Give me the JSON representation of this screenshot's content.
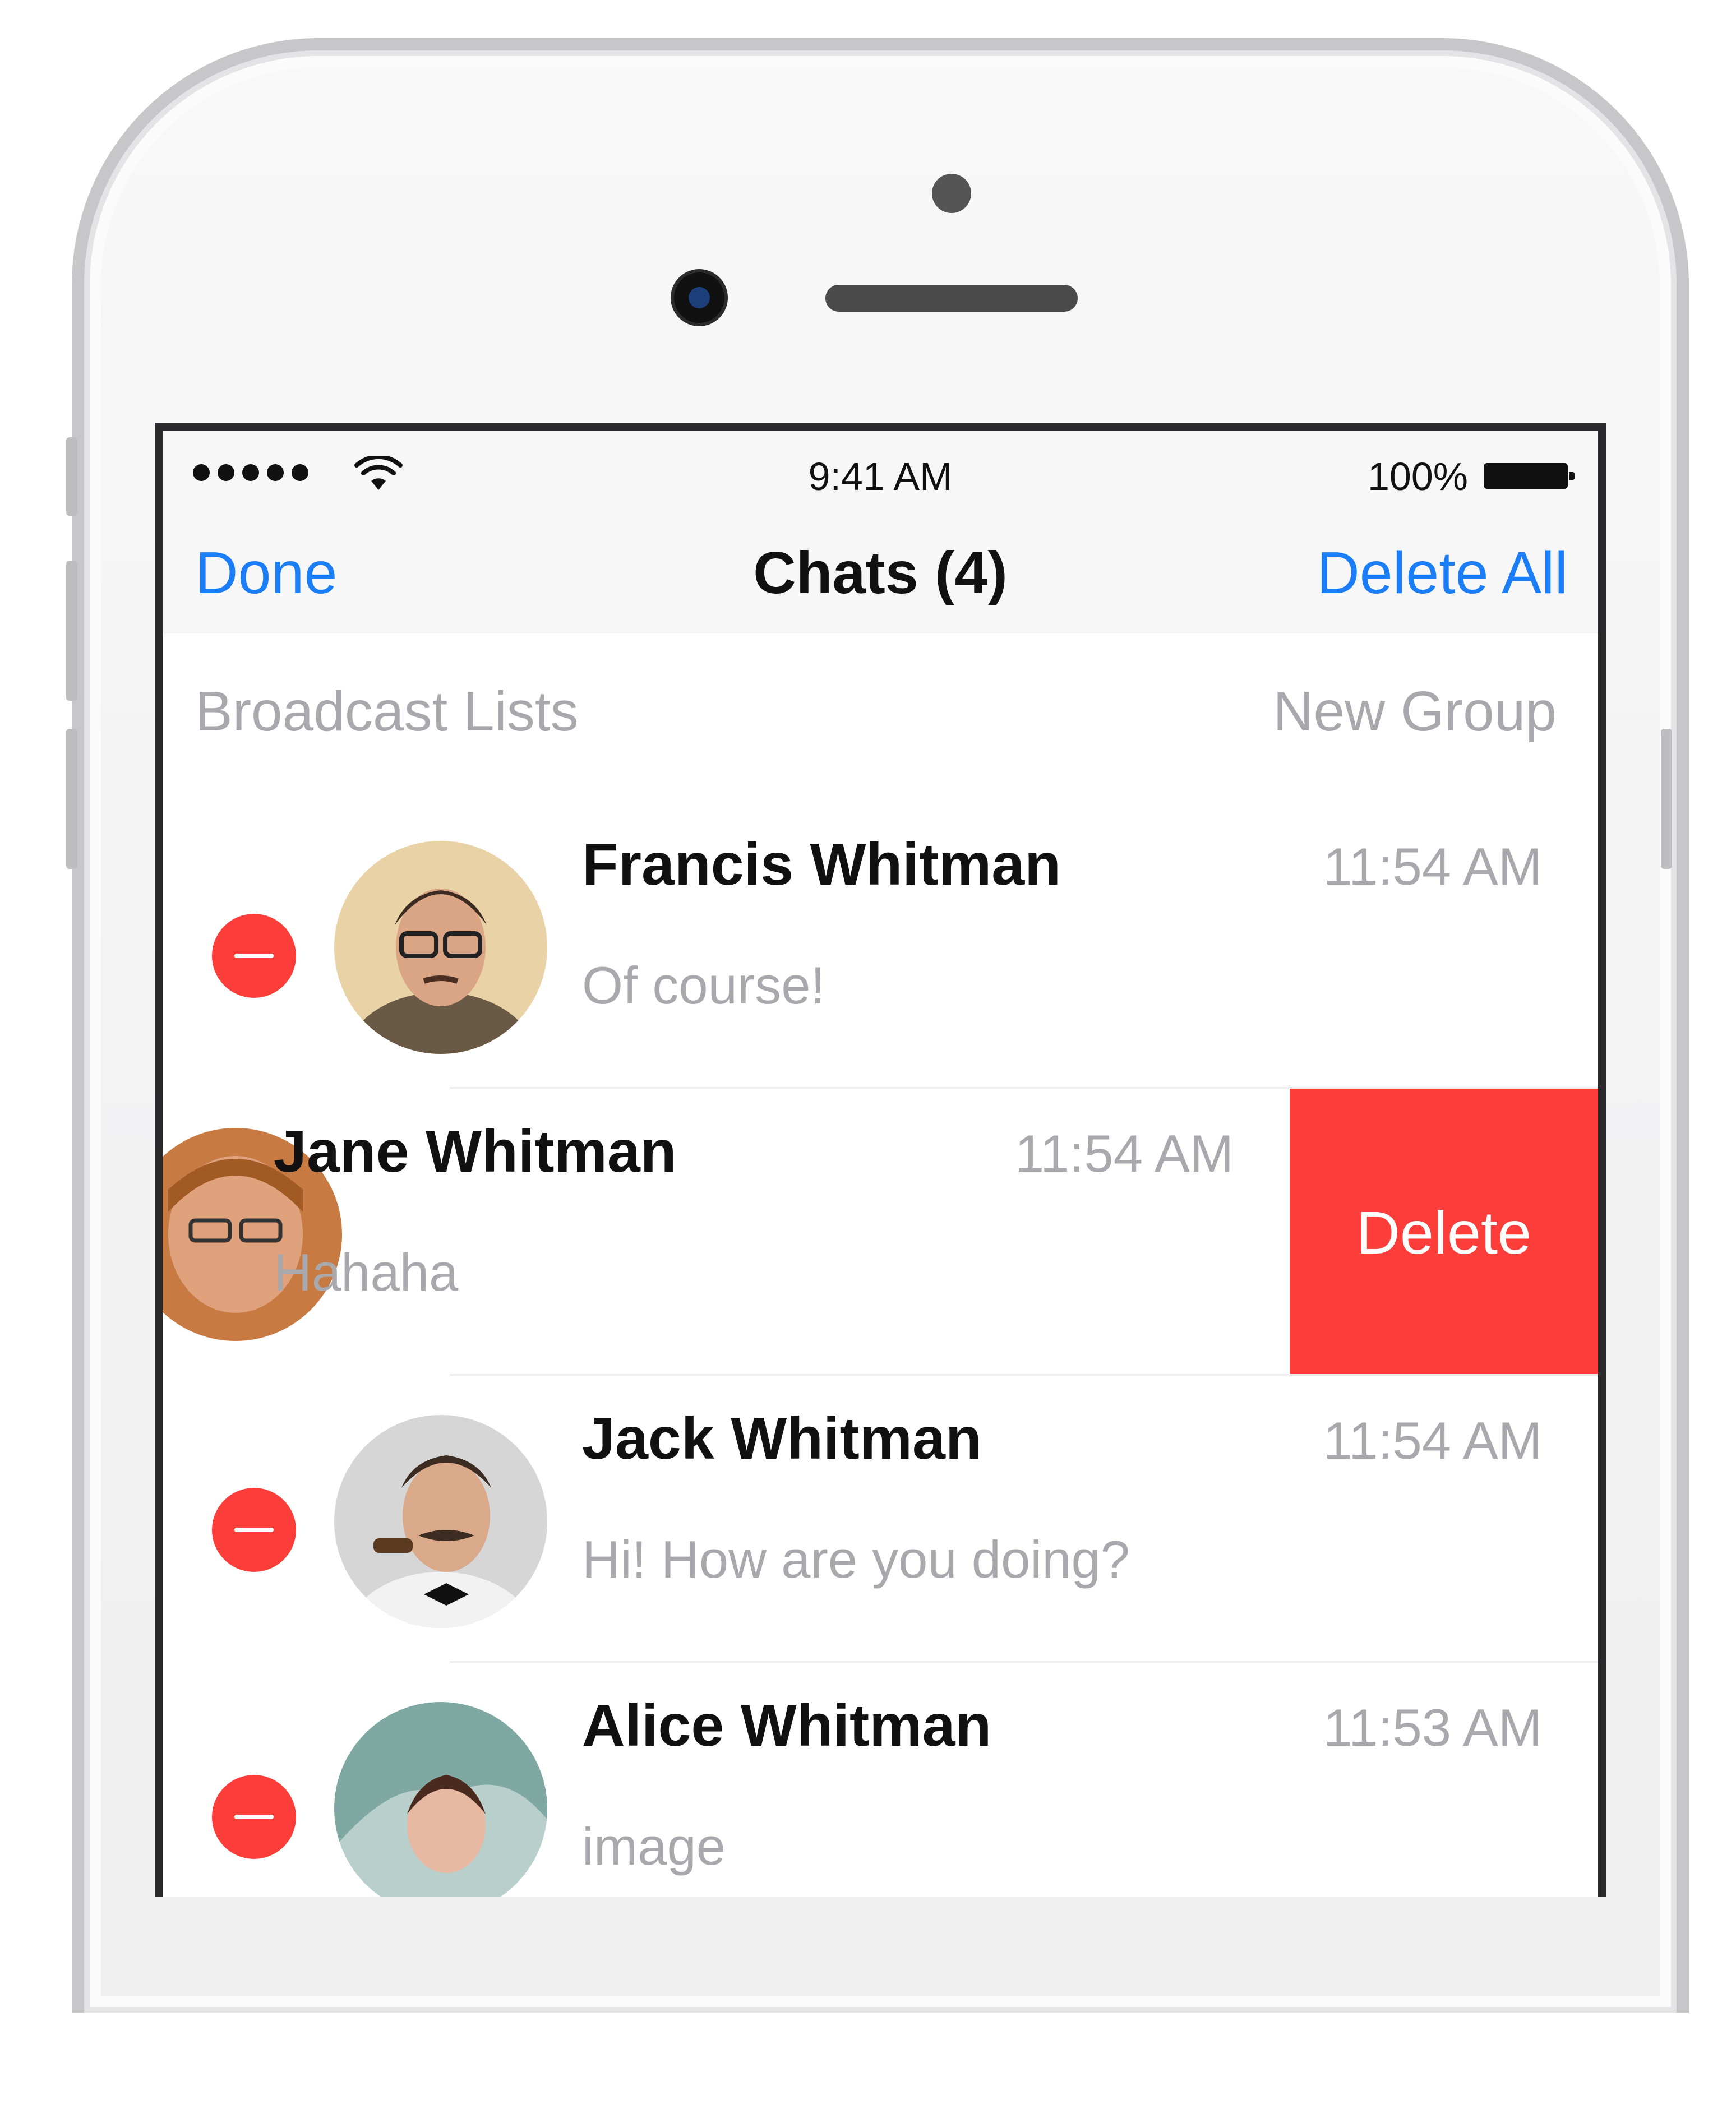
{
  "status_bar": {
    "time": "9:41 AM",
    "battery": "100%",
    "signal_icon": "signal-dots-icon",
    "wifi_icon": "wifi-icon",
    "battery_icon": "battery-icon"
  },
  "nav": {
    "left_label": "Done",
    "title": "Chats (4)",
    "right_label": "Delete All"
  },
  "subbar": {
    "left_label": "Broadcast Lists",
    "right_label": "New Group"
  },
  "chats": [
    {
      "name": "Francis Whitman",
      "time": "11:54 AM",
      "message": "Of course!",
      "state": "edit"
    },
    {
      "name": "Jane Whitman",
      "time": "11:54 AM",
      "message": "Hahaha",
      "state": "swiped",
      "action_label": "Delete"
    },
    {
      "name": "Jack Whitman",
      "time": "11:54 AM",
      "message": "Hi! How are you doing?",
      "state": "edit"
    },
    {
      "name": "Alice Whitman",
      "time": "11:53 AM",
      "message": "image",
      "state": "edit"
    }
  ],
  "colors": {
    "accent_blue": "#1b7ef7",
    "delete_red": "#fc3d39",
    "secondary_gray": "#a9a9ad"
  }
}
